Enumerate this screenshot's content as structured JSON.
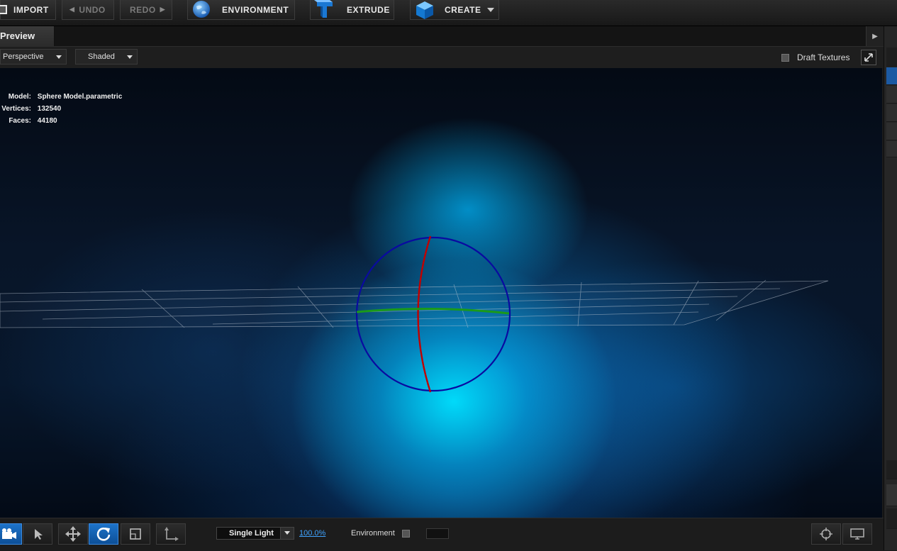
{
  "toolbar": {
    "import_label": "IMPORT",
    "undo_label": "UNDO",
    "redo_label": "REDO",
    "environment_label": "ENVIRONMENT",
    "extrude_label": "EXTRUDE",
    "create_label": "CREATE"
  },
  "preview": {
    "tab_label": "Preview",
    "projection": "Perspective",
    "shading": "Shaded",
    "draft_textures_label": "Draft Textures",
    "draft_textures_checked": false
  },
  "model_info": {
    "model_key": "Model:",
    "model_value": "Sphere Model.parametric",
    "vertices_key": "Vertices:",
    "vertices_value": "132540",
    "faces_key": "Faces:",
    "faces_value": "44180"
  },
  "bottom": {
    "light_mode": "Single Light",
    "intensity": "100.0%",
    "environment_label": "Environment",
    "environment_checked": false
  },
  "icons": {
    "import": "import-box-icon",
    "environment": "globe-icon",
    "extrude": "extrude-t-icon",
    "create": "cube-icon",
    "camera": "camera-icon",
    "select": "pointer-icon",
    "move": "move-arrows-icon",
    "rotate": "rotate-icon",
    "scale": "scale-square-icon",
    "axis": "axis-icon",
    "target": "crosshair-icon",
    "display": "monitor-icon"
  },
  "colors": {
    "accent": "#1d73c9",
    "gizmo_x": "#c00000",
    "gizmo_y": "#1a9a1a",
    "gizmo_z": "#0a0aa0"
  }
}
